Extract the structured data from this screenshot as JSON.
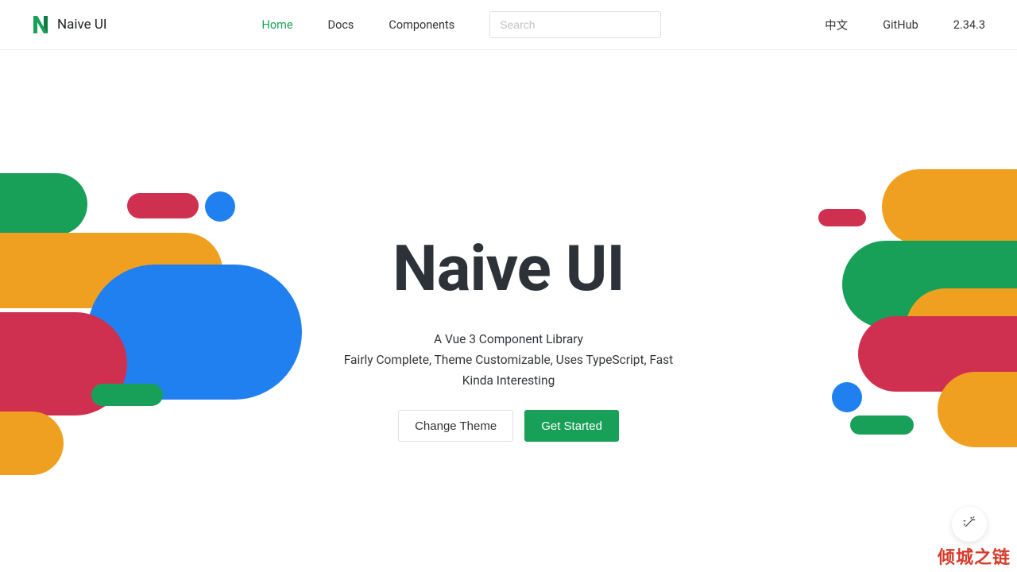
{
  "header": {
    "logo_text": "Naive UI",
    "nav": [
      {
        "label": "Home",
        "active": true
      },
      {
        "label": "Docs",
        "active": false
      },
      {
        "label": "Components",
        "active": false
      }
    ],
    "search_placeholder": "Search",
    "right": {
      "lang": "中文",
      "github": "GitHub",
      "version": "2.34.3"
    }
  },
  "hero": {
    "title": "Naive UI",
    "subtitle_lines": [
      "A Vue 3 Component Library",
      "Fairly Complete, Theme Customizable, Uses TypeScript, Fast",
      "Kinda Interesting"
    ],
    "buttons": {
      "change_theme": "Change Theme",
      "get_started": "Get Started"
    }
  },
  "colors": {
    "green": "#18a058",
    "yellow": "#f0a020",
    "red": "#d03050",
    "blue": "#2080f0"
  },
  "watermark": "倾城之链"
}
